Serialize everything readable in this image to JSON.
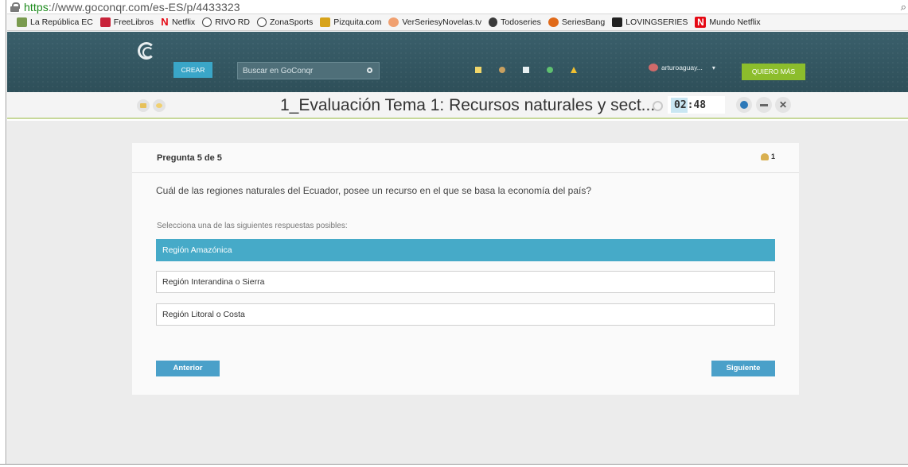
{
  "browser": {
    "url_scheme": "https",
    "url_rest": "://www.goconqr.com/es-ES/p/4433323"
  },
  "bookmarks": [
    {
      "label": "La República EC",
      "icon": "flag-icon"
    },
    {
      "label": "FreeLibros",
      "icon": "book-icon"
    },
    {
      "label": "Netflix",
      "icon": "netflix-icon"
    },
    {
      "label": "RIVO RD",
      "icon": "ball-icon"
    },
    {
      "label": "ZonaSports",
      "icon": "ball-icon"
    },
    {
      "label": "Pizquita.com",
      "icon": "pizza-icon"
    },
    {
      "label": "VerSeriesyNovelas.tv",
      "icon": "vs-icon"
    },
    {
      "label": "Todoseries",
      "icon": "todoseries-icon"
    },
    {
      "label": "SeriesBang",
      "icon": "seriesbang-icon"
    },
    {
      "label": "LOVINGSERIES",
      "icon": "lovingseries-icon"
    },
    {
      "label": "Mundo Netflix",
      "icon": "netflix-icon"
    }
  ],
  "header": {
    "create_label": "CREAR",
    "search_placeholder": "Buscar en GoConqr",
    "username": "arturoaguay...",
    "upgrade_label": "QUIERO MÁS"
  },
  "quiz": {
    "title": "1_Evaluación Tema 1: Recursos naturales y sect...",
    "timer_min": "02",
    "timer_sec": ":48",
    "question_counter": "Pregunta 5 de 5",
    "participants": "1",
    "question": "Cuál de las regiones naturales del Ecuador, posee un recurso en el que se basa la economía del país?",
    "hint": "Selecciona una de las siguientes respuestas posibles:",
    "options": [
      "Región Amazónica",
      "Región Interandina o Sierra",
      "Región Litoral o Costa"
    ],
    "selected_option": 0,
    "prev_label": "Anterior",
    "next_label": "Siguiente"
  },
  "colors": {
    "header_bg": "#2e4f59",
    "accent_blue": "#46aac8",
    "accent_green": "#8cbd2c"
  }
}
